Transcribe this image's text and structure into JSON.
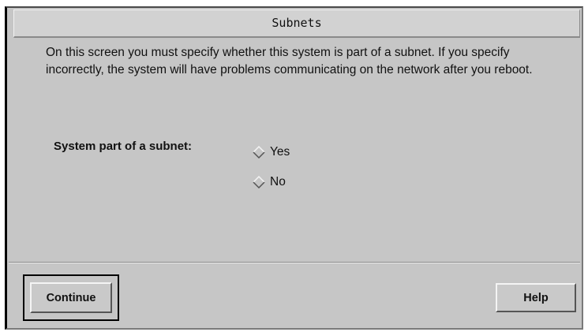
{
  "window": {
    "title": "Subnets"
  },
  "content": {
    "intro": "On this screen you must specify whether this system is part of a subnet.  If you specify incorrectly, the system will have problems communicating on the network after you reboot.",
    "field_label": "System part of a subnet:",
    "options": [
      {
        "label": "Yes",
        "selected": false
      },
      {
        "label": "No",
        "selected": false
      }
    ]
  },
  "buttons": {
    "continue_label": "Continue",
    "help_label": "Help"
  },
  "colors": {
    "window_bg": "#c6c6c6",
    "titlebar_bg": "#d2d2d2",
    "text": "#111111"
  },
  "icons": {
    "radio": "diamond-radio-icon"
  }
}
